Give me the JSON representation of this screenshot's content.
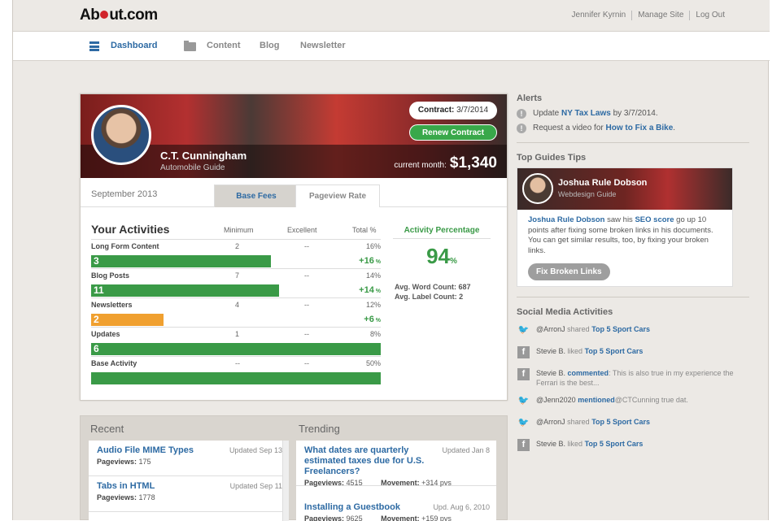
{
  "brand": {
    "logo": "About.com"
  },
  "top_links": [
    "Jennifer Kyrnin",
    "Manage Site",
    "Log Out"
  ],
  "nav": {
    "dashboard": "Dashboard",
    "content": "Content",
    "blog": "Blog",
    "newsletter": "Newsletter"
  },
  "profile": {
    "name": "C.T. Cunningham",
    "role": "Automobile Guide",
    "contract_label": "Contract:",
    "contract_date": "3/7/2014",
    "renew": "Renew Contract",
    "month_label": "current month:",
    "month_value": "$1,340"
  },
  "tabs": {
    "period": "September 2013",
    "base": "Base Fees",
    "pageview": "Pageview Rate"
  },
  "activities": {
    "title": "Your Activities",
    "cols": [
      "Minimum",
      "Excellent",
      "Total %"
    ],
    "rows": [
      {
        "label": "Long Form Content",
        "minimum": "2",
        "excellent": "--",
        "total": "16%",
        "count": "3",
        "progress": 0.62,
        "delta": "+16",
        "color": "#3a9a47"
      },
      {
        "label": "Blog Posts",
        "minimum": "7",
        "excellent": "--",
        "total": "14%",
        "count": "11",
        "progress": 0.65,
        "delta": "+14",
        "color": "#3a9a47"
      },
      {
        "label": "Newsletters",
        "minimum": "4",
        "excellent": "--",
        "total": "12%",
        "count": "2",
        "progress": 0.25,
        "delta": "+6",
        "color": "#f0a030"
      },
      {
        "label": "Updates",
        "minimum": "1",
        "excellent": "--",
        "total": "8%",
        "count": "6",
        "progress": 1.0,
        "delta": "",
        "color": "#3a9a47"
      },
      {
        "label": "Base Activity",
        "minimum": "--",
        "excellent": "--",
        "total": "50%",
        "count": "",
        "progress": 1.0,
        "delta": "",
        "color": "#3a9a47"
      }
    ]
  },
  "percentage": {
    "title": "Activity Percentage",
    "value": "94",
    "unit": "%",
    "word_count": "Avg. Word Count: 687",
    "label_count": "Avg. Label Count: 2"
  },
  "recent": {
    "title": "Recent",
    "items": [
      {
        "title": "Audio File MIME Types",
        "date": "Updated Sep 13",
        "pv_label": "Pageviews:",
        "pv": "175"
      },
      {
        "title": "Tabs in HTML",
        "date": "Updated Sep 11",
        "pv_label": "Pageviews:",
        "pv": "1778"
      }
    ]
  },
  "trending": {
    "title": "Trending",
    "items": [
      {
        "title": "What dates are quarterly estimated taxes due for U.S. Freelancers?",
        "date": "Updated Jan 8",
        "pv_label": "Pageviews:",
        "pv": "4515",
        "mv_label": "Movement:",
        "mv": "+314 pvs"
      },
      {
        "title": "Installing a Guestbook",
        "date": "Upd. Aug 6, 2010",
        "pv_label": "Pageviews:",
        "pv": "9625",
        "mv_label": "Movement:",
        "mv": "+159 pvs"
      }
    ]
  },
  "alerts": {
    "title": "Alerts",
    "items": [
      {
        "pre": "Update",
        "link": "NY Tax Laws",
        "post": "by 3/7/2014."
      },
      {
        "pre": "Request a video for",
        "link": "How to Fix a Bike",
        "post": "."
      }
    ]
  },
  "tips": {
    "title": "Top Guides Tips",
    "name": "Joshua Rule Dobson",
    "role": "Webdesign Guide",
    "body_link1": "Joshua Rule Dobson",
    "body_mid": "saw his",
    "body_link2": "SEO score",
    "body_rest": "go up 10 points after fixing some broken links in his documents. You can get similar results, too, by fixing your broken links.",
    "button": "Fix Broken Links"
  },
  "social": {
    "title": "Social Media Activities",
    "items": [
      {
        "icon": "twitter-icon",
        "user": "@ArronJ",
        "action": "shared",
        "target": "Top 5 Sport Cars",
        "extra": ""
      },
      {
        "icon": "facebook-icon",
        "user": "Stevie B.",
        "action": "liked",
        "target": "Top 5 Sport Cars",
        "extra": ""
      },
      {
        "icon": "facebook-icon",
        "user": "Stevie B.",
        "action": "",
        "target": "commented",
        "extra": ": This is also true in my experience the Ferrari is the best..."
      },
      {
        "icon": "twitter-icon",
        "user": "@Jenn2020",
        "action": "",
        "target": "mentioned",
        "extra": "@CTCunning true dat."
      },
      {
        "icon": "twitter-icon",
        "user": "@ArronJ",
        "action": "shared",
        "target": "Top 5 Sport Cars",
        "extra": ""
      },
      {
        "icon": "facebook-icon",
        "user": "Stevie B.",
        "action": "liked",
        "target": "Top 5 Sport Cars",
        "extra": ""
      }
    ]
  }
}
